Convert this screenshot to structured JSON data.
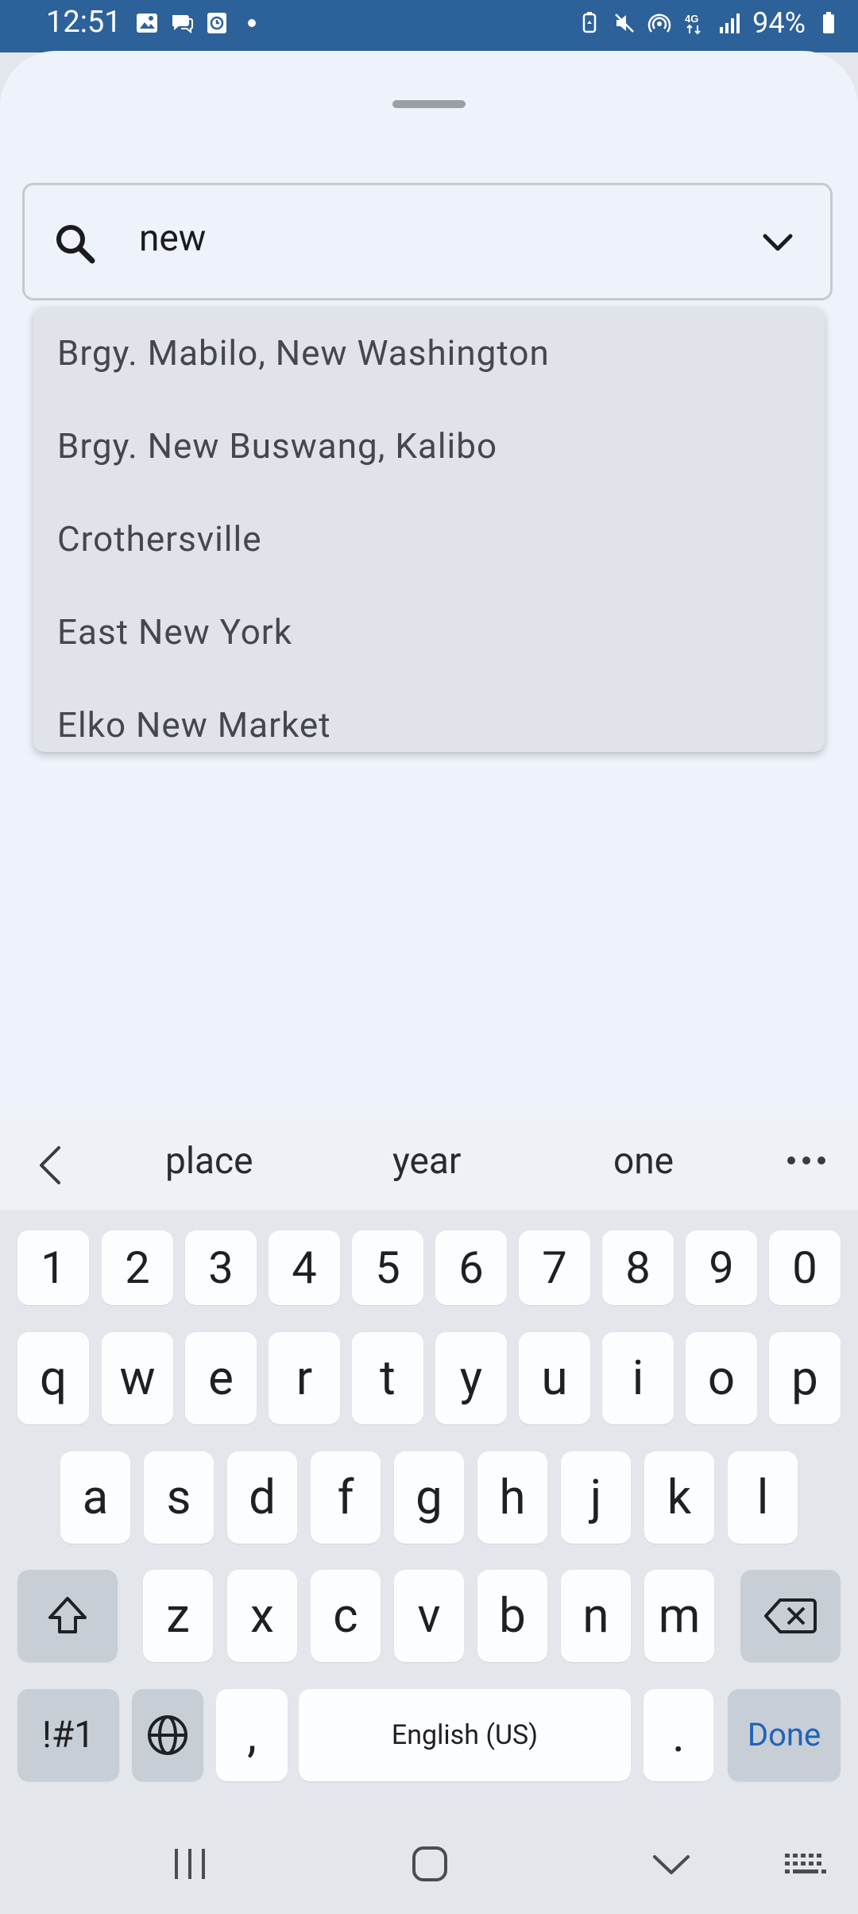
{
  "status_bar": {
    "time": "12:51",
    "battery": "94%",
    "network": "4G",
    "left_icons": [
      "image-icon",
      "chat-icon",
      "clock-app-icon",
      "dot-icon"
    ],
    "right_icons": [
      "battery-saver-icon",
      "mute-icon",
      "hotspot-icon",
      "network-4g-icon",
      "signal-icon",
      "battery-icon"
    ]
  },
  "search": {
    "value": "new"
  },
  "dropdown": {
    "items": [
      "Brgy. Mabilo, New Washington",
      "Brgy. New Buswang, Kalibo",
      "Crothersville",
      "East New York",
      "Elko New Market"
    ]
  },
  "keyboard": {
    "suggestions": [
      "place",
      "year",
      "one"
    ],
    "number_row": [
      "1",
      "2",
      "3",
      "4",
      "5",
      "6",
      "7",
      "8",
      "9",
      "0"
    ],
    "row1": [
      "q",
      "w",
      "e",
      "r",
      "t",
      "y",
      "u",
      "i",
      "o",
      "p"
    ],
    "row2": [
      "a",
      "s",
      "d",
      "f",
      "g",
      "h",
      "j",
      "k",
      "l"
    ],
    "row3": [
      "z",
      "x",
      "c",
      "v",
      "b",
      "n",
      "m"
    ],
    "symbols_label": "!#1",
    "comma": ",",
    "space_label": "English (US)",
    "period": ".",
    "done_label": "Done",
    "done_color": "#1e63b8"
  },
  "colors": {
    "status_bar": "#2d6199",
    "sheet": "#eef2fa",
    "dropdown": "#e1e3ea"
  }
}
